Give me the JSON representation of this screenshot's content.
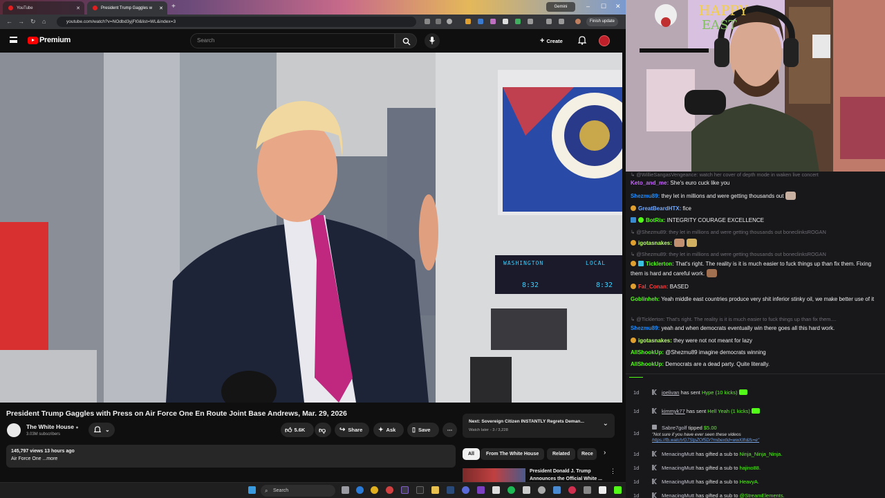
{
  "browser": {
    "tabs": [
      {
        "label": "YouTube"
      },
      {
        "label": "President Trump Gaggles w"
      }
    ],
    "gemini_label": "Gemini",
    "url": "youtube.com/watch?v=NOdbd3yjFt0&list=WL&index=3",
    "finish_update_label": "Finish update"
  },
  "youtube": {
    "logo_label": "Premium",
    "search_placeholder": "Search",
    "create_label": "Create",
    "video": {
      "overlay_left": "WASHINGTON",
      "overlay_right": "LOCAL",
      "time_left": "8:32",
      "time_right": "8:32"
    },
    "title": "President Trump Gaggles with Press on Air Force One En Route Joint Base Andrews, Mar. 29, 2026",
    "channel": {
      "name": "The White House",
      "subscribers": "3.03M subscribers"
    },
    "actions": {
      "likes": "5.6K",
      "share": "Share",
      "ask": "Ask",
      "save": "Save"
    },
    "description": {
      "stats": "145,797 views  13 hours ago",
      "snippet": "Air Force One ...more"
    },
    "next": {
      "title": "Next: Sovereign Citizen INSTANTLY Regrets Deman...",
      "subtitle": "Watch later - 3 / 3,228"
    },
    "chips": [
      "All",
      "From The White House",
      "Related",
      "Rece"
    ],
    "related": {
      "title": "President Donald J. Trump Announces the Official White ..."
    }
  },
  "taskbar": {
    "search_label": "Search"
  },
  "chat": {
    "messages": [
      {
        "kind": "reply",
        "text": "@WillieSangasVengeance: watch her cover of depth mode in waken live concert"
      },
      {
        "user": "Keto_and_me:",
        "user_color": "#c864ff",
        "text": " She's euro cuck like you"
      },
      {
        "user": "Shezmu89:",
        "user_color": "#1e90ff",
        "text": " they let in millions and were getting thousands out"
      },
      {
        "user": "GreatBeardHTX:",
        "user_color": "#6fa8ff",
        "text": " fice"
      },
      {
        "user": "BotRix:",
        "user_color": "#53fc18",
        "text": " INTEGRITY COURAGE EXCELLENCE"
      },
      {
        "kind": "reply",
        "text": "@Shezmu89: they let in millions and were getting thousands out boneclinksROGAN"
      },
      {
        "user": "igotasnakes:",
        "user_color": "#b8ff6a",
        "text": ""
      },
      {
        "kind": "reply",
        "text": "@Shezmu89: they let in millions and were getting thousands out boneclinksROGAN"
      },
      {
        "user": "Ticklerton:",
        "user_color": "#53fc18",
        "text": " That's right. The reality is it is much easier to fuck things up than fix them. Fixing them is hard and careful work."
      },
      {
        "user": "Fal_Conan:",
        "user_color": "#ff3b3b",
        "text": " BASED"
      },
      {
        "user": "Goblinheh:",
        "user_color": "#53fc18",
        "text": " Yeah middle east countries produce very shit inferior stinky oil, we make better use of it"
      },
      {
        "kind": "reply",
        "text": "@Ticklerton: That's right. The reality is it is much easier to fuck things up than fix them...."
      },
      {
        "user": "Shezmu89:",
        "user_color": "#1e90ff",
        "text": " yeah and when democrats eventually win there goes all this hard work."
      },
      {
        "user": "igotasnakes:",
        "user_color": "#b8ff6a",
        "text": " they were not not meant for lazy"
      },
      {
        "user": "AllShookUp:",
        "user_color": "#53fc18",
        "text": " @Shezmu89 imagine democrats winning"
      },
      {
        "user": "AllShookUp:",
        "user_color": "#53fc18",
        "text": " Democrats are a dead party. Quite literally."
      }
    ]
  },
  "events": [
    {
      "age": "1d",
      "name": "joelivan",
      "mid": " has sent ",
      "highlight": "Hype (10 kicks)"
    },
    {
      "age": "1d",
      "name": "kimmyk77",
      "mid": " has sent ",
      "highlight": "Hell Yeah (1 kicks)"
    },
    {
      "age": "1d",
      "name": "Sabre7golf",
      "mid": " tipped ",
      "highlight": "$5.00",
      "note": "\"Not sure if you have ever seen these videos",
      "link": "https://fb.watch/G7StpZOf5D/?mibextid=wwXIfr&fs=e\""
    },
    {
      "age": "1d",
      "name": "MenacingMutt",
      "mid": " has gifted a sub to ",
      "highlight": "Ninja_Ninja_Ninja."
    },
    {
      "age": "1d",
      "name": "MenacingMutt",
      "mid": " has gifted a sub to ",
      "highlight": "hajino88."
    },
    {
      "age": "1d",
      "name": "MenacingMutt",
      "mid": " has gifted a sub to ",
      "highlight": "HeavyA."
    },
    {
      "age": "1d",
      "name": "MenacingMutt",
      "mid": " has gifted a sub to ",
      "highlight": "@StreamElements."
    }
  ],
  "colors": {
    "yt_red": "#ff0000",
    "kick_green": "#53fc18",
    "chat_bg": "#18181b"
  }
}
